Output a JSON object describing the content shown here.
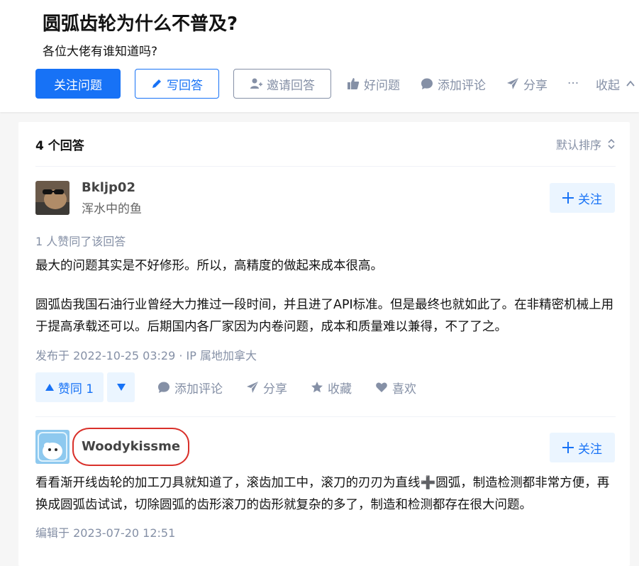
{
  "question": {
    "title": "圆弧齿轮为什么不普及?",
    "detail": "各位大佬有谁知道吗?",
    "buttons": {
      "follow": "关注问题",
      "write_answer": "写回答",
      "invite": "邀请回答"
    },
    "actions": {
      "good_question": "好问题",
      "add_comment": "添加评论",
      "share": "分享",
      "more": "···",
      "collapse": "收起"
    }
  },
  "answers_header": {
    "count_label": "4 个回答",
    "sort_label": "默认排序"
  },
  "answers": [
    {
      "author": "Bkljp02",
      "bio": "浑水中的鱼",
      "follow_label": "关注",
      "voters": "1 人赞同了该回答",
      "paragraphs": [
        "最大的问题其实是不好修形。所以，高精度的做起来成本很高。",
        "圆弧齿我国石油行业曾经大力推过一段时间，并且进了API标准。但是最终也就如此了。在非精密机械上用于提高承载还可以。后期国内各厂家因为内卷问题，成本和质量难以兼得，不了了之。"
      ],
      "meta": "发布于 2022-10-25 03:29 · IP 属地加拿大",
      "actions": {
        "upvote": "赞同 1",
        "comment": "添加评论",
        "share": "分享",
        "collect": "收藏",
        "like": "喜欢"
      }
    },
    {
      "author": "Woodykissme",
      "follow_label": "关注",
      "paragraphs": [
        "看看渐开线齿轮的加工刀具就知道了，滚齿加工中，滚刀的刃刃为直线➕圆弧，制造检测都非常方便，再换成圆弧齿试试，切除圆弧的齿形滚刀的齿形就复杂的多了，制造和检测都存在很大问题。"
      ],
      "meta": "编辑于 2023-07-20 12:51"
    }
  ],
  "colors": {
    "brand_blue": "#1772f6",
    "light_blue_bg": "#ebf5ff",
    "muted_gray": "#8590a6",
    "annotation_red": "#d9302a"
  }
}
